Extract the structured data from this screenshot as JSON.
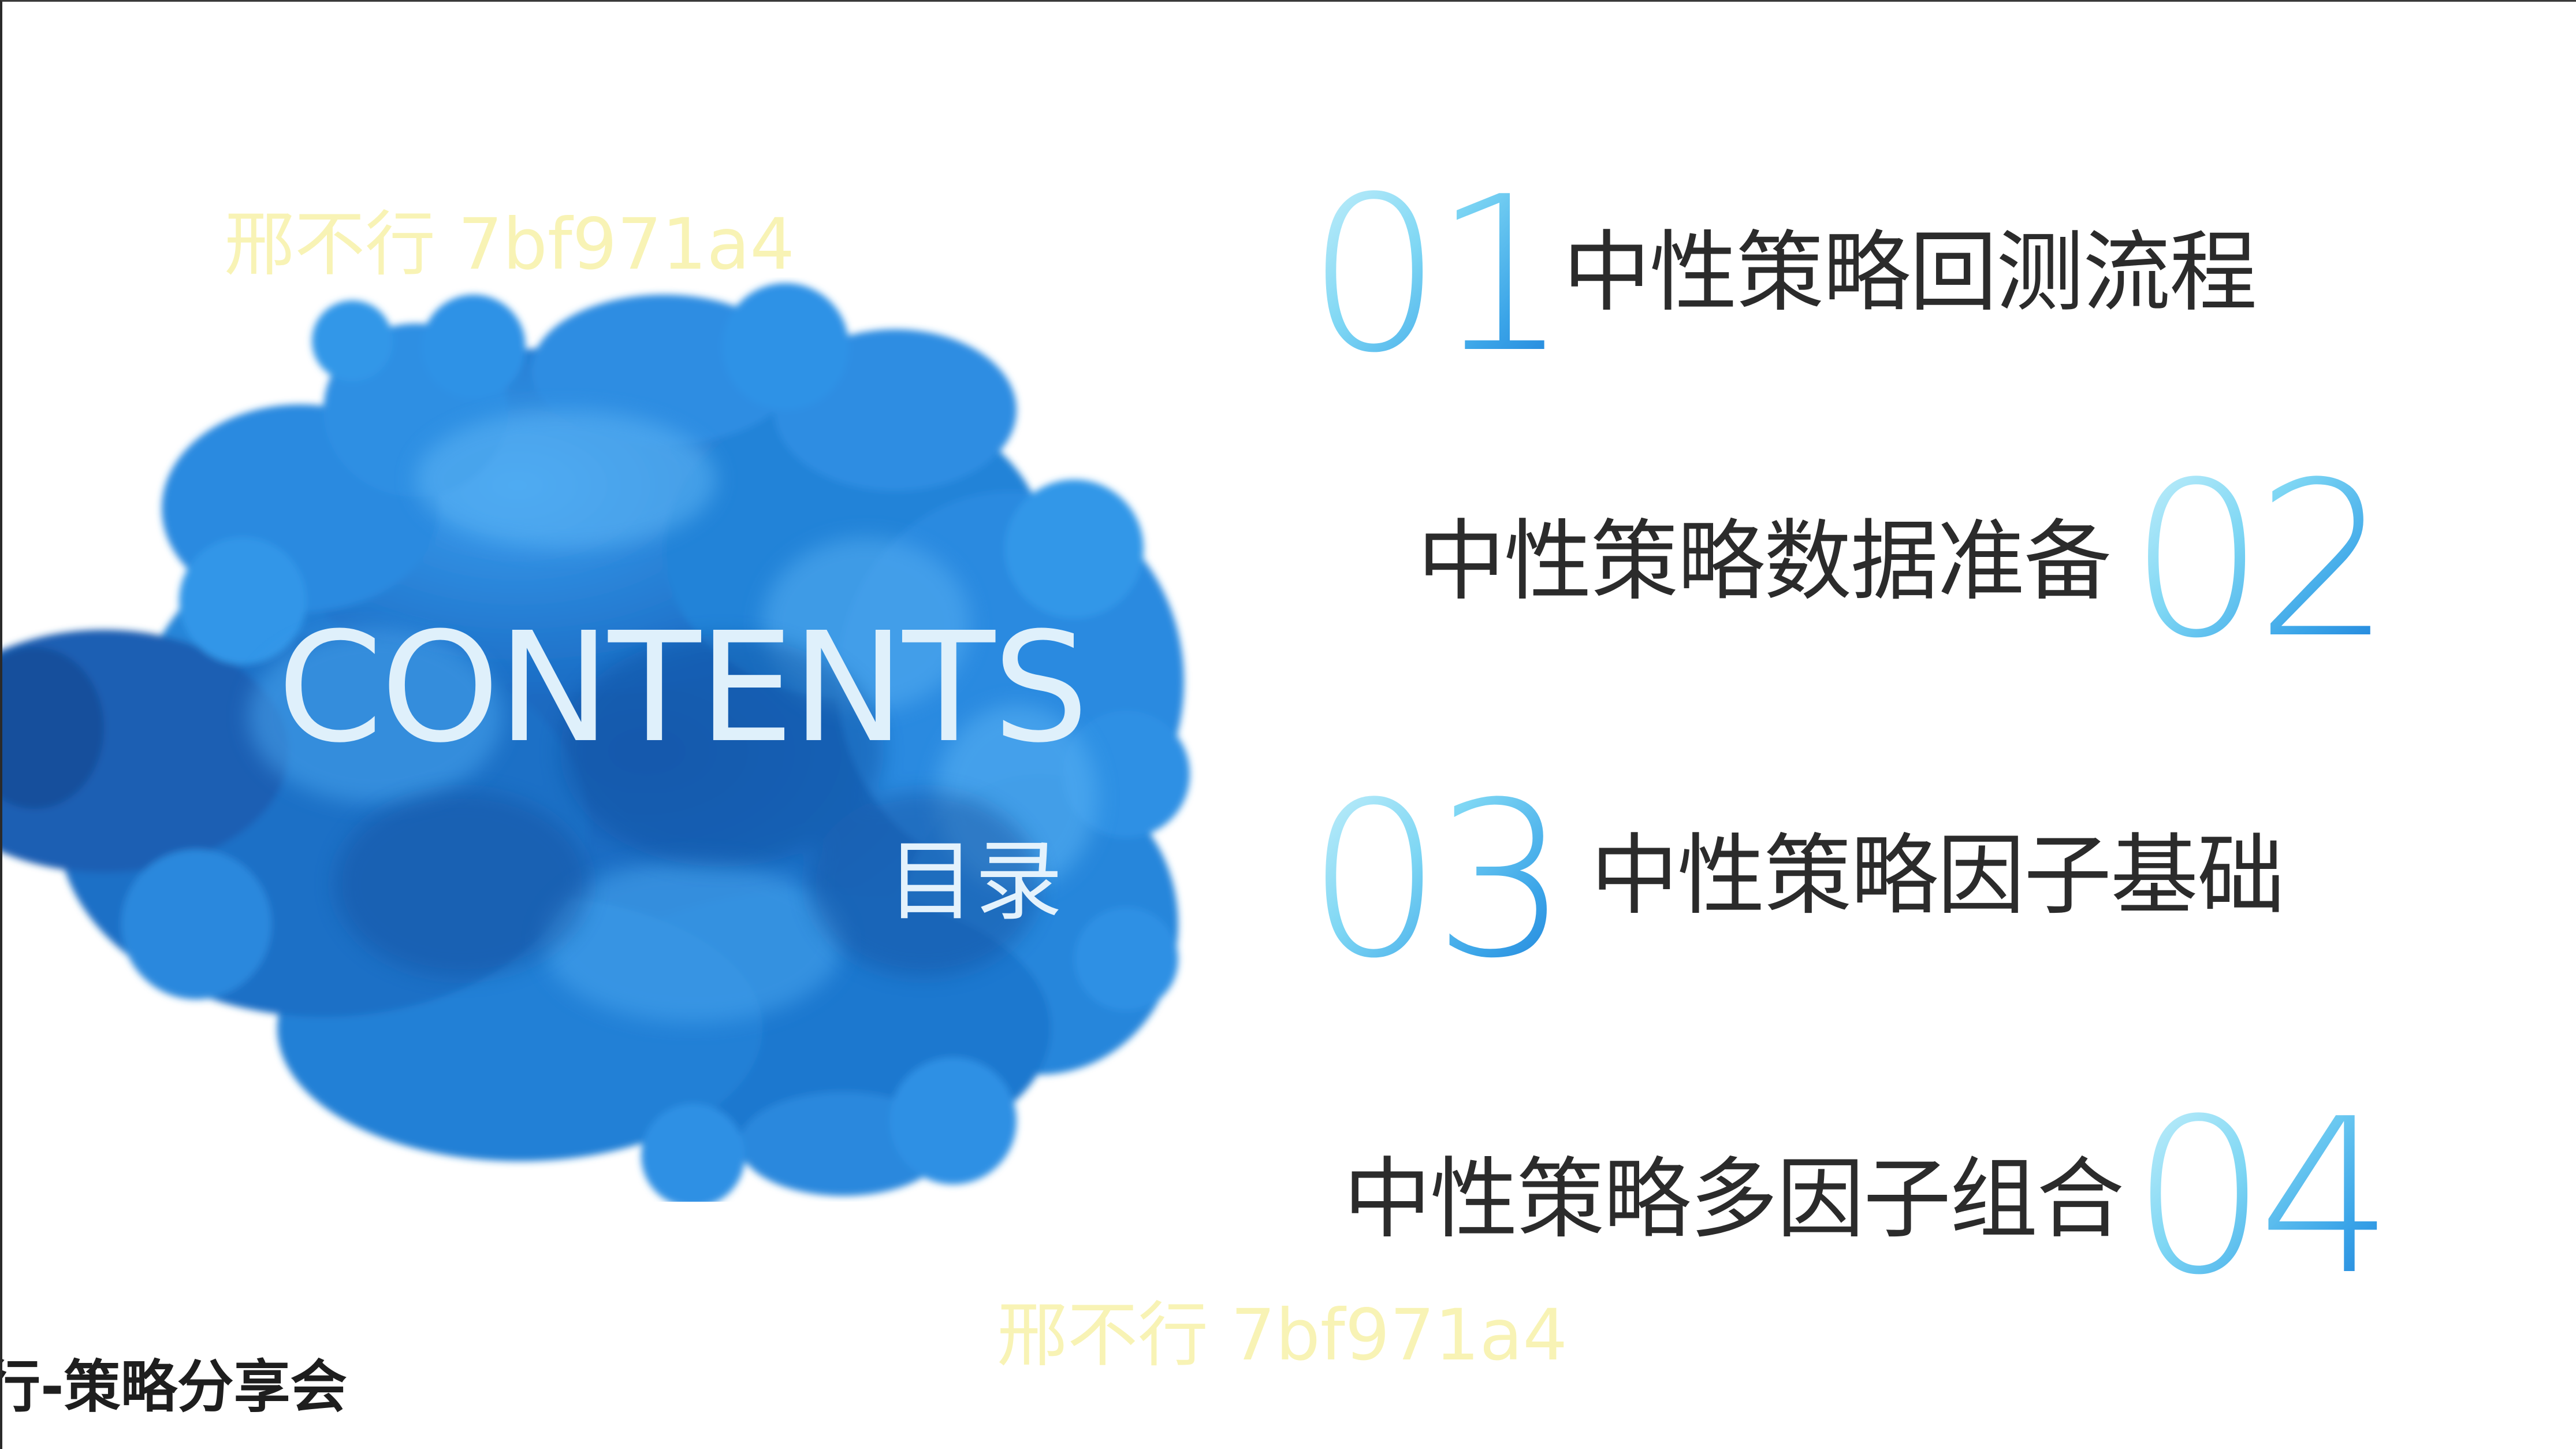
{
  "slide": {
    "title": "CONTENTS",
    "subtitle": "目录"
  },
  "items": [
    {
      "number": "01",
      "label": "中性策略回测流程"
    },
    {
      "number": "02",
      "label": "中性策略数据准备"
    },
    {
      "number": "03",
      "label": "中性策略因子基础"
    },
    {
      "number": "04",
      "label": "中性策略多因子组合"
    }
  ],
  "watermarks": [
    "邢不行 7bf971a4",
    "邢不行 7bf971a4"
  ],
  "footer": {
    "text": "行-策略分享会"
  },
  "colors": {
    "ink_blue": "#1f78cf",
    "number_light": "#9fe2f7",
    "number_dark": "#1e7fd9",
    "text_dark": "#2b2b2b",
    "watermark": "#f6f0a0"
  }
}
